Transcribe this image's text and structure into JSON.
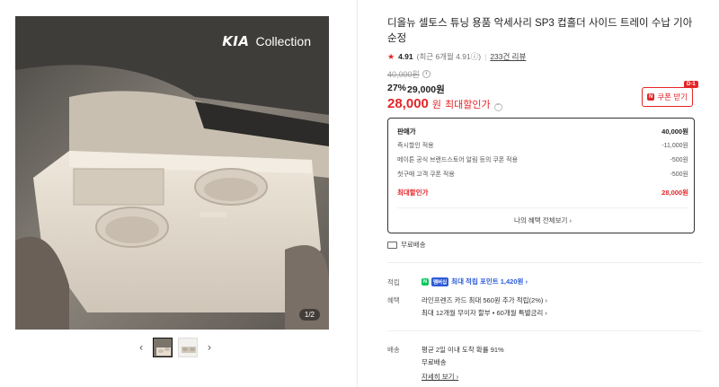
{
  "gallery": {
    "brand_logo": "KIA",
    "brand_text": "Collection",
    "counter": "1/2",
    "prev_icon": "‹",
    "next_icon": "›"
  },
  "product": {
    "title": "디올뉴 셀토스 튜닝 용품 악세사리 SP3 컵홀더 사이드 트레이 수납 기아 순정",
    "rating": {
      "score": "4.91",
      "recent": "(최근 6개월 4.91",
      "recent_close": ")",
      "reviews": "233건 리뷰"
    },
    "original_price": "40,000원",
    "sale_pct": "27%",
    "sale_price": "29,000원",
    "max_price": "28,000",
    "max_won": "원",
    "max_label": "최대할인가",
    "coupon_label": "쿠폰 받기",
    "coupon_badge": "N",
    "d_badge": "D-1"
  },
  "breakdown": {
    "rows": [
      {
        "label": "판매가",
        "value": "40,000원",
        "kind": "head"
      },
      {
        "label": "즉시할인 적용",
        "value": "-11,000원",
        "kind": "normal"
      },
      {
        "label": "메이튼 공식 브랜드스토어 알림 등의 쿠폰 적용",
        "value": "-500원",
        "kind": "normal"
      },
      {
        "label": "첫구매 고객 쿠폰 적용",
        "value": "-500원",
        "kind": "normal"
      }
    ],
    "max_label": "최대할인가",
    "max_value": "28,000원",
    "all_benefits": "나의 혜택 전체보기 ›"
  },
  "shipping_free": "무료배송",
  "points": {
    "label": "적립",
    "npay": "N",
    "plus": "멤버십",
    "text": "최대 적립 포인트 1,420원 ›"
  },
  "benefits": {
    "label": "혜택",
    "line1": "라인프렌즈 카드 최대 560원 추가 적립(2%) ›",
    "line2": "최대 12개월 무이자 할부 • 60개월 특별금리 ›"
  },
  "delivery": {
    "label": "배송",
    "line1": "평균 2일 이내 도착 확률 91%",
    "line2": "무료배송",
    "more": "자세히 보기 ›"
  }
}
